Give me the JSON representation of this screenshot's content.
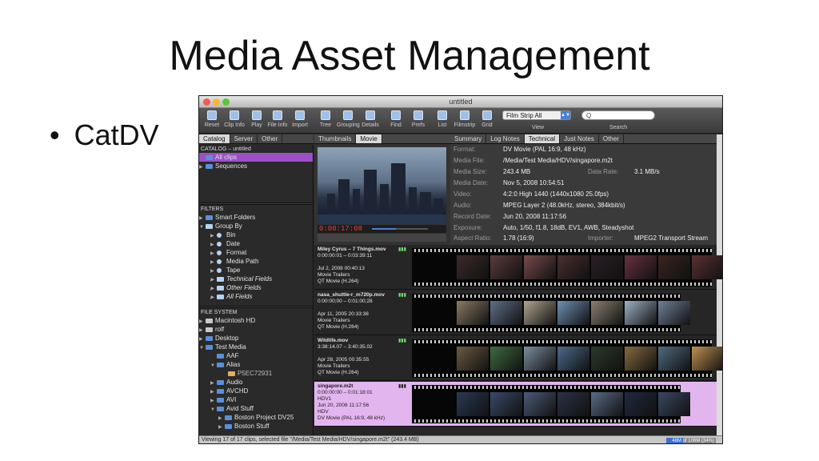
{
  "slide": {
    "title": "Media Asset Management",
    "bullet": "CatDV"
  },
  "window": {
    "title": "untitled",
    "traffic_colors": [
      "#f25a55",
      "#f5b935",
      "#5dc43a"
    ]
  },
  "toolbar": {
    "buttons": [
      {
        "label": "Reset",
        "icon": "reset-icon"
      },
      {
        "label": "Clip Info",
        "icon": "info-icon"
      },
      {
        "label": "Play",
        "icon": "play-icon"
      },
      {
        "label": "File Info",
        "icon": "file-icon"
      },
      {
        "label": "Import",
        "icon": "import-icon"
      },
      {
        "label": "Tree",
        "icon": "tree-icon"
      },
      {
        "label": "Grouping",
        "icon": "grouping-icon"
      },
      {
        "label": "Details",
        "icon": "details-icon"
      },
      {
        "label": "Find",
        "icon": "find-icon"
      },
      {
        "label": "Prefs",
        "icon": "prefs-icon"
      },
      {
        "label": "List",
        "icon": "list-icon"
      },
      {
        "label": "Filmstrip",
        "icon": "filmstrip-icon"
      },
      {
        "label": "Grid",
        "icon": "grid-icon"
      }
    ],
    "view_select": "Film Strip All",
    "view_label": "View",
    "search_placeholder": "Q",
    "search_label": "Search"
  },
  "left_tabs": [
    "Catalog",
    "Server",
    "Other"
  ],
  "catalog": {
    "header": "CATALOG – untitled",
    "items": [
      "All clips",
      "Sequences"
    ]
  },
  "filters": {
    "header": "FILTERS",
    "smart": "Smart Folders",
    "group": "Group By",
    "items": [
      "Bin",
      "Date",
      "Format",
      "Media Path",
      "Tape"
    ],
    "italic_items": [
      "Technical Fields",
      "Other Fields",
      "All Fields"
    ]
  },
  "filesystem": {
    "header": "FILE SYSTEM",
    "items": [
      "Macintosh HD",
      "rolf",
      "Desktop",
      "Test Media",
      "AAF",
      "Alias",
      "P5EC72931",
      "Audio",
      "AVCHD",
      "AVI",
      "Avid Stuff",
      "Boston Project DV25",
      "Boston Stuff"
    ]
  },
  "preview": {
    "tabs": [
      "Thumbnails",
      "Movie"
    ],
    "timecode": "0:00:17:08"
  },
  "info": {
    "tabs": [
      "Summary",
      "Log Notes",
      "Technical",
      "Just Notes",
      "Other"
    ],
    "rows": [
      {
        "k": "Format:",
        "v": "DV Movie (PAL 16:9, 48 kHz)"
      },
      {
        "k": "Media File:",
        "v": "/Media/Test Media/HDV/singapore.m2t"
      },
      {
        "k": "Media Size:",
        "v": "243.4 MB",
        "k2": "Data Rate:",
        "v2": "3.1 MB/s"
      },
      {
        "k": "Media Date:",
        "v": "Nov 5, 2008 10:54:51"
      },
      {
        "k": "Video:",
        "v": "4:2:0 High 1440 (1440x1080 25.0fps)"
      },
      {
        "k": "Audio:",
        "v": "MPEG Layer 2 (48.0kHz, stereo, 384kbit/s)"
      },
      {
        "k": "Record Date:",
        "v": "Jun 20, 2008 11:17:56"
      },
      {
        "k": "Exposure:",
        "v": "Auto, 1/50, f1.8, 18dB, EV1, AWB, Steadyshot"
      },
      {
        "k": "Aspect Ratio:",
        "v": "1.78 (16:9)",
        "k2": "Importer:",
        "v2": "MPEG2 Transport Stream"
      }
    ]
  },
  "clips": [
    {
      "name": "Miley Cyrus – 7 Things.mov",
      "tc": "0:00:00:01 – 0:03:39:11",
      "date": "Jul 2, 2008 00:40:13",
      "bin": "Movie Trailers",
      "fmt": "QT Movie (H.264)",
      "badge": "▮▮▮"
    },
    {
      "name": "nasa_shuttle-r_m720p.mov",
      "tc": "0:00:00;00 – 0:01:00;28",
      "date": "Apr 11, 2005 20:33:38",
      "bin": "Movie Trailers",
      "fmt": "QT Movie (H.264)",
      "badge": "▮▮▮"
    },
    {
      "name": "Wildlife.mov",
      "tc": "3:38:14.07 – 3:40:35.02",
      "date": "Apr 28, 2005 00:35:55",
      "bin": "Movie Trailers",
      "fmt": "QT Movie (H.264)",
      "badge": "▮▮▮"
    },
    {
      "name": "singapore.m2t",
      "tc": "0:00:00:00 – 0:01:18:01",
      "date": "HDV1",
      "bin": "Jun 20, 2008 11:17:56",
      "fmt": "HDV",
      "fmt2": "DV Movie (PAL 16:9, 48 kHz)",
      "badge": "▮▮▮"
    }
  ],
  "status": {
    "text": "Viewing 17 of 17 clips, selected file \"/Media/Test Media/HDV/singapore.m2t\" (243.4 MB)",
    "memory": "48M of 106M (34%)",
    "memory_fraction": 0.34
  }
}
